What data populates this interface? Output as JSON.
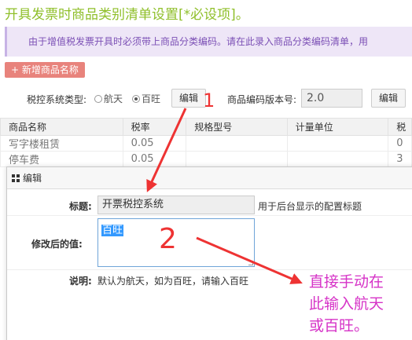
{
  "page_title": "开具发票时商品类别清单设置[*必设项]。",
  "notice": "由于增值税发票开具时必须带上商品分类编码。请在此录入商品分类编码清单，用",
  "add_button": "+ 新增商品名称",
  "tax_system": {
    "label": "税控系统类型:",
    "options": [
      "航天",
      "百旺"
    ],
    "selected": "百旺",
    "edit_label": "编辑"
  },
  "code_version": {
    "label": "商品编码版本号:",
    "value": "2.0",
    "edit_label": "编辑"
  },
  "table": {
    "headers": [
      "商品名称",
      "税率",
      "规格型号",
      "计量单位",
      "税"
    ],
    "rows": [
      [
        "写字楼租赁",
        "0.05",
        "",
        "",
        "0"
      ],
      [
        "停车费",
        "0.05",
        "",
        "",
        "3"
      ]
    ]
  },
  "modal": {
    "title": "编辑",
    "title_label": "标题:",
    "title_value": "开票税控系统",
    "title_hint": "用于后台显示的配置标题",
    "value_label": "修改后的值:",
    "value_text": "百旺",
    "desc_label": "说明:",
    "desc_text": "默认为航天，如为百旺，请输入百旺"
  },
  "annotations": {
    "mark1": "1",
    "mark2": "2",
    "note_lines": [
      "直接手动在",
      "此输入航天",
      "或百旺。"
    ],
    "arrow_color": "#ee3333",
    "note_color": "#d633c7"
  }
}
